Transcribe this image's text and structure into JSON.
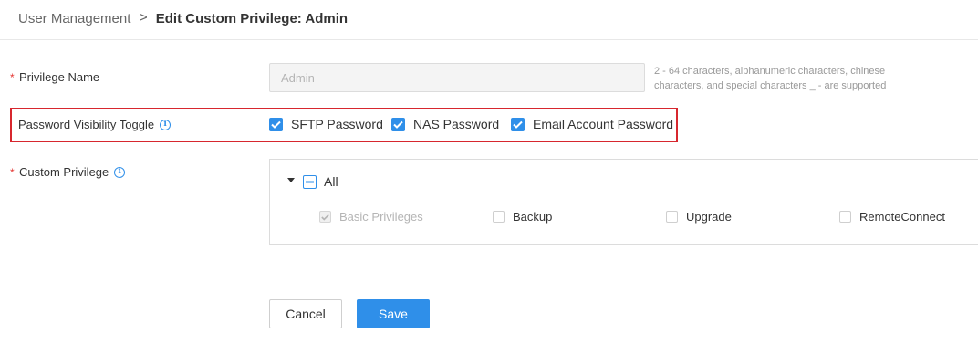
{
  "breadcrumb": {
    "parent": "User Management",
    "separator": ">",
    "current": "Edit Custom Privilege: Admin"
  },
  "form": {
    "privilege_name": {
      "required": "*",
      "label": "Privilege Name",
      "value": "Admin",
      "hint": "2 - 64 characters, alphanumeric characters, chinese characters, and special characters _ - are supported"
    },
    "password_visibility": {
      "label": "Password Visibility Toggle",
      "info_icon": "info-icon",
      "options": [
        {
          "label": "SFTP Password",
          "checked": true
        },
        {
          "label": "NAS Password",
          "checked": true
        },
        {
          "label": "Email Account Password",
          "checked": true
        }
      ]
    },
    "custom_privilege": {
      "required": "*",
      "label": "Custom Privilege",
      "info_icon": "info-icon",
      "all": {
        "label": "All",
        "state": "indeterminate",
        "expanded": true
      },
      "items": [
        {
          "label": "Basic Privileges",
          "checked": true,
          "disabled": true
        },
        {
          "label": "Backup",
          "checked": false
        },
        {
          "label": "Upgrade",
          "checked": false
        },
        {
          "label": "RemoteConnect",
          "checked": false
        }
      ]
    }
  },
  "actions": {
    "cancel": "Cancel",
    "save": "Save"
  },
  "colors": {
    "accent": "#2f8fe9",
    "required": "#e53935",
    "highlight": "#d7272e"
  }
}
